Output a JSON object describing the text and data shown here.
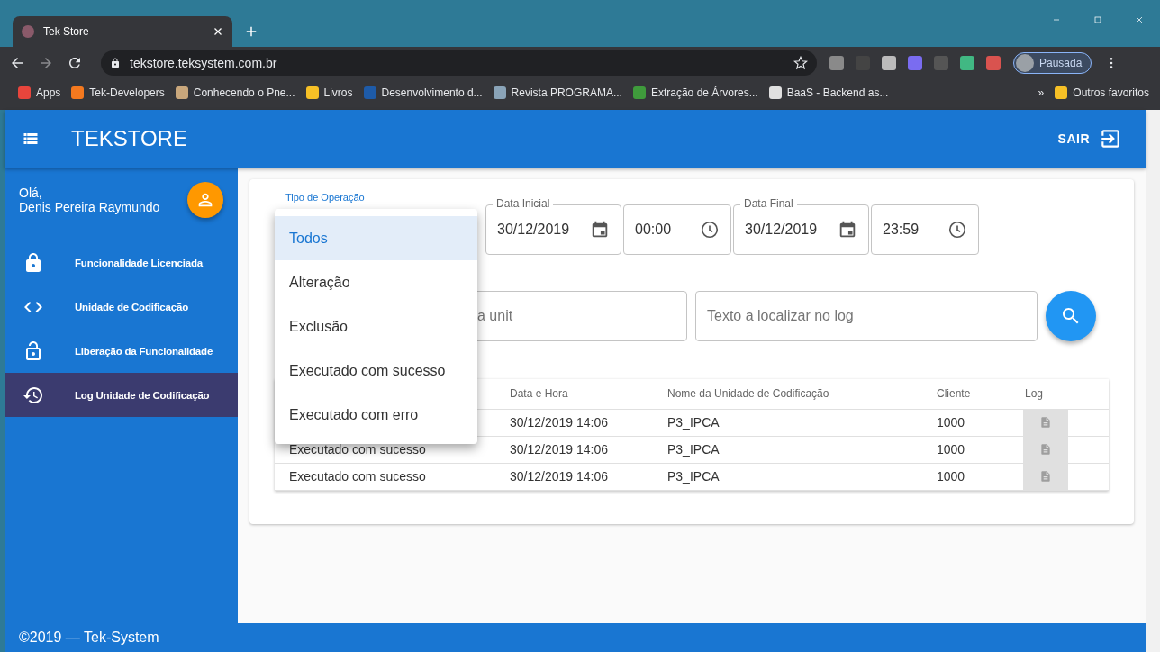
{
  "browser": {
    "tab_title": "Tek Store",
    "url": "tekstore.teksystem.com.br",
    "profile": "Pausada",
    "bookmarks": [
      {
        "label": "Apps",
        "color": "#e8453c"
      },
      {
        "label": "Tek-Developers",
        "color": "#f4791f"
      },
      {
        "label": "Conhecendo o Pne...",
        "color": "#c9a77c"
      },
      {
        "label": "Livros",
        "color": "#f6c026"
      },
      {
        "label": "Desenvolvimento d...",
        "color": "#1e5ba8"
      },
      {
        "label": "Revista PROGRAMA...",
        "color": "#8aa4b8"
      },
      {
        "label": "Extração de Árvores...",
        "color": "#3f9b3c"
      },
      {
        "label": "BaaS - Backend as...",
        "color": "#e0e0e0"
      }
    ],
    "overflow": "»",
    "other_bookmarks": "Outros favoritos"
  },
  "app": {
    "title": "TEKSTORE",
    "logout": "SAIR"
  },
  "sidebar": {
    "greeting": "Olá,",
    "user_name": "Denis Pereira Raymundo",
    "items": [
      {
        "label": "Funcionalidade Licenciada",
        "selected": false
      },
      {
        "label": "Unidade de Codificação",
        "selected": false
      },
      {
        "label": "Liberação da Funcionalidade",
        "selected": false
      },
      {
        "label": "Log Unidade de Codificação",
        "selected": true
      }
    ]
  },
  "filters": {
    "operation_type_label": "Tipo de Operação",
    "datetime_fields": [
      {
        "kind": "date",
        "label": "Data Inicial",
        "value": "30/12/2019"
      },
      {
        "kind": "time",
        "value": "00:00"
      },
      {
        "kind": "date",
        "label": "Data Final",
        "value": "30/12/2019"
      },
      {
        "kind": "time",
        "value": "23:59"
      }
    ],
    "unit_search": {
      "placeholder": "a unit"
    },
    "log_search": {
      "placeholder": "Texto a localizar no log"
    }
  },
  "dropdown": {
    "options": [
      {
        "label": "Todos",
        "selected": true
      },
      {
        "label": "Alteração",
        "selected": false
      },
      {
        "label": "Exclusão",
        "selected": false
      },
      {
        "label": "Executado com sucesso",
        "selected": false
      },
      {
        "label": "Executado com erro",
        "selected": false
      }
    ]
  },
  "table": {
    "columns": [
      "",
      "Data e Hora",
      "Nome da Unidade de Codificação",
      "Cliente",
      "Log"
    ],
    "rows": [
      {
        "cells": [
          "",
          "30/12/2019 14:06",
          "P3_IPCA",
          "1000"
        ]
      },
      {
        "cells": [
          "Executado com sucesso",
          "30/12/2019 14:06",
          "P3_IPCA",
          "1000"
        ]
      },
      {
        "cells": [
          "Executado com sucesso",
          "30/12/2019 14:06",
          "P3_IPCA",
          "1000"
        ]
      }
    ]
  },
  "footer": "©2019 — Tek-System"
}
